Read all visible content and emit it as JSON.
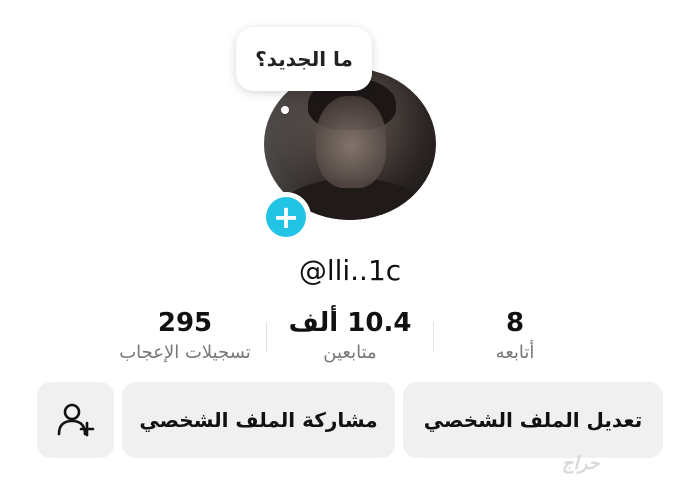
{
  "profile": {
    "bubble_text": "ما الجديد؟",
    "username": "@lli..1c"
  },
  "stats": {
    "following": {
      "value": "8",
      "label": "أتابعه"
    },
    "followers": {
      "value": "10.4 ألف",
      "label": "متابعين"
    },
    "likes": {
      "value": "295",
      "label": "تسجيلات الإعجاب"
    }
  },
  "actions": {
    "edit_label": "تعديل الملف الشخصي",
    "share_label": "مشاركة الملف الشخصي"
  },
  "icons": {
    "add_story": "plus-icon",
    "add_friend": "add-user-icon"
  },
  "colors": {
    "accent": "#22c4e6",
    "button_bg": "#f0f0f0"
  },
  "watermark": "حراج"
}
